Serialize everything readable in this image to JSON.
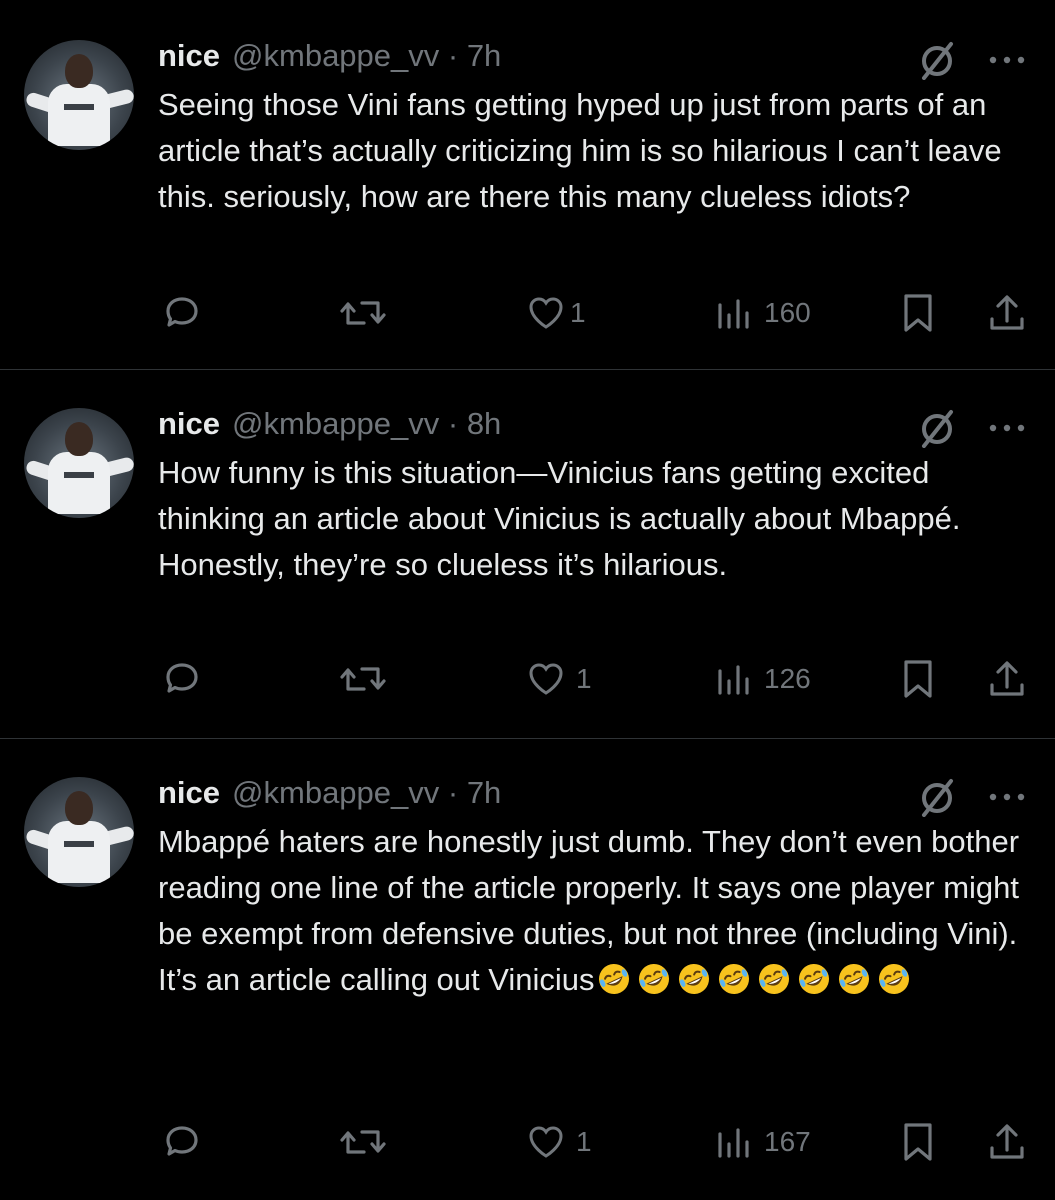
{
  "tweets": [
    {
      "name": "nice",
      "handle": "@kmbappe_vv · 7h",
      "text": "Seeing those Vini fans getting hyped up just from parts of an article that’s actually criticizing him is so hilarious I can’t leave this. seriously, how are there this many clueless idiots?",
      "likes": "1",
      "views": "160"
    },
    {
      "name": "nice",
      "handle": "@kmbappe_vv · 8h",
      "text": "How funny is this situation—Vinicius fans getting excited thinking an article about Vinicius is actually about Mbappé. Honestly, they’re so clueless it’s hilarious.",
      "likes": "1",
      "views": "126"
    },
    {
      "name": "nice",
      "handle": "@kmbappe_vv · 7h",
      "text": "Mbappé haters are honestly just dumb. They don’t even bother reading one line of the article properly. It says one player might be exempt from defensive duties, but not three (including Vini). It’s an article calling out Vinicius",
      "emoji": "rolling-on-floor-laughing",
      "emoji_count": 8,
      "likes": "1",
      "views": "167"
    }
  ],
  "icons": {
    "reply": "speech-bubble-icon",
    "repost": "repost-arrows-icon",
    "like": "heart-icon",
    "views": "bar-chart-icon",
    "bookmark": "bookmark-icon",
    "share": "share-upload-icon",
    "grok": "slashed-circle-icon",
    "more": "ellipsis-icon"
  },
  "colors": {
    "background": "#000000",
    "text": "#e7e9ea",
    "muted": "#71767b",
    "separator": "#2f3336"
  }
}
